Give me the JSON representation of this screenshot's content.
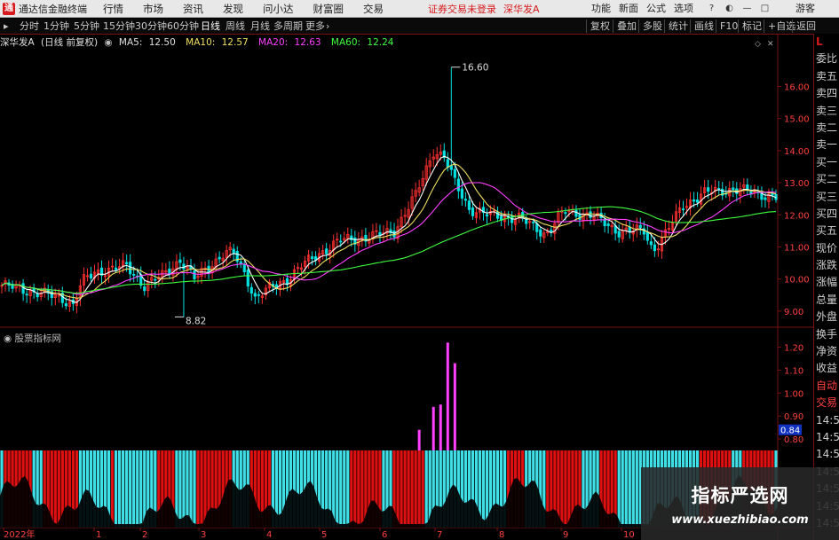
{
  "app": {
    "title": "通达信金融终端",
    "logo": "通"
  },
  "menu": [
    "行情",
    "市场",
    "资讯",
    "发现",
    "问小达",
    "财富圈",
    "交易"
  ],
  "notice": "证券交易未登录",
  "notice_stock": "深华发A",
  "right_menu": [
    "功能",
    "新面",
    "公式",
    "选项",
    "游客"
  ],
  "periods": [
    "分时",
    "1分钟",
    "5分钟",
    "15分钟",
    "30分钟",
    "60分钟",
    "日线",
    "周线",
    "月线",
    "多周期",
    "更多"
  ],
  "active_period": "日线",
  "tools": [
    "复权",
    "叠加",
    "多股",
    "统计",
    "画线",
    "F10",
    "标记",
    "+自选",
    "返回"
  ],
  "info": {
    "stock": "深华发A",
    "mode": "(日线 前复权)",
    "ma5_label": "MA5:",
    "ma5_value": "12.50",
    "ma10_label": "MA10:",
    "ma10_value": "12.57",
    "ma20_label": "MA20:",
    "ma20_value": "12.63",
    "ma60_label": "MA60:",
    "ma60_value": "12.24"
  },
  "indicator_name": "股票指标网",
  "colors": {
    "up": "#ff3030",
    "down": "#00e0e0",
    "ma5": "#ffffff",
    "ma10": "#f0e060",
    "ma20": "#ff40ff",
    "ma60": "#40ff40",
    "grid": "#7a1010",
    "axis_text": "#ff4040",
    "indicator_pink": "#ff40ff",
    "indicator_red": "#e01010",
    "indicator_cyan": "#40e0e8"
  },
  "chart_data": [
    {
      "type": "candlestick",
      "y_ticks": [
        "16.00",
        "15.00",
        "14.00",
        "13.00",
        "12.00",
        "11.00",
        "10.00",
        "9.00"
      ],
      "ylim": [
        8.5,
        17.2
      ],
      "annotations": [
        {
          "text": "16.60",
          "value": 16.6
        },
        {
          "text": "8.82",
          "value": 8.82
        }
      ],
      "x_labels": [
        "2022年",
        "1",
        "2",
        "3",
        "4",
        "5",
        "6",
        "7",
        "8",
        "9",
        "10"
      ]
    },
    {
      "type": "bar",
      "y_ticks": [
        "1.20",
        "1.10",
        "1.00",
        "0.90",
        "0.80"
      ],
      "ylim": [
        0.75,
        1.26
      ],
      "current_value": "0.84",
      "pink_bars": [
        0.84,
        0.94,
        0.95,
        1.22,
        1.13
      ]
    }
  ],
  "right_panel": [
    "委比",
    "卖五",
    "卖四",
    "卖三",
    "卖二",
    "卖一",
    "买一",
    "买二",
    "买三",
    "买四",
    "买五",
    "现价",
    "涨跌",
    "涨幅",
    "总量",
    "外盘",
    "换手",
    "净资",
    "收益",
    "自动",
    "交易",
    "14:55",
    "14:55",
    "14:55",
    "14:55",
    "14:55",
    "14:56",
    "14:56"
  ],
  "right_panel_top": "L",
  "watermark": {
    "title": "指标严选网",
    "url": "www.xuezhibiao.com"
  }
}
